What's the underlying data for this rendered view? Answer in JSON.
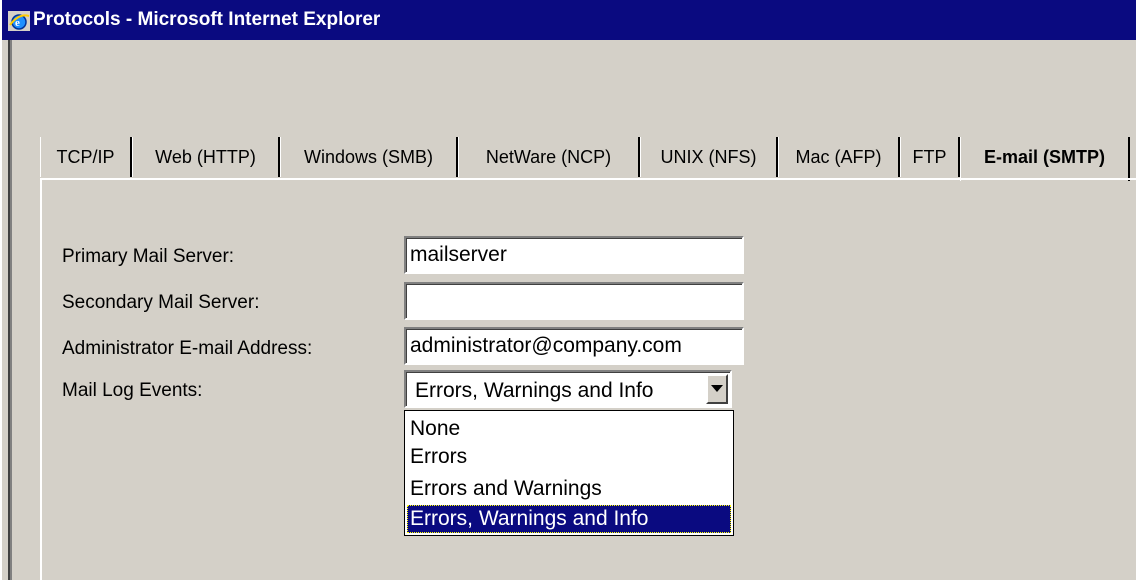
{
  "window": {
    "title": "Protocols - Microsoft Internet Explorer",
    "icon": "ie-icon"
  },
  "tabs": [
    {
      "label": "TCP/IP",
      "active": false
    },
    {
      "label": "Web (HTTP)",
      "active": false
    },
    {
      "label": "Windows (SMB)",
      "active": false
    },
    {
      "label": "NetWare (NCP)",
      "active": false
    },
    {
      "label": "UNIX (NFS)",
      "active": false
    },
    {
      "label": "Mac (AFP)",
      "active": false
    },
    {
      "label": "FTP",
      "active": false
    },
    {
      "label": "E-mail (SMTP)",
      "active": true
    }
  ],
  "form": {
    "primary_label": "Primary Mail Server:",
    "primary_value": "mailserver",
    "secondary_label": "Secondary Mail Server:",
    "secondary_value": "",
    "admin_label": "Administrator E-mail Address:",
    "admin_value": "administrator@company.com",
    "log_label": "Mail Log Events:",
    "log_value": "Errors, Warnings and Info",
    "log_options": [
      "None",
      "Errors",
      "Errors and Warnings",
      "Errors, Warnings and Info"
    ],
    "log_selected_index": 3
  },
  "colors": {
    "titlebar": "#0a0a80",
    "face": "#d4d0c8",
    "selection": "#0a0a80"
  }
}
